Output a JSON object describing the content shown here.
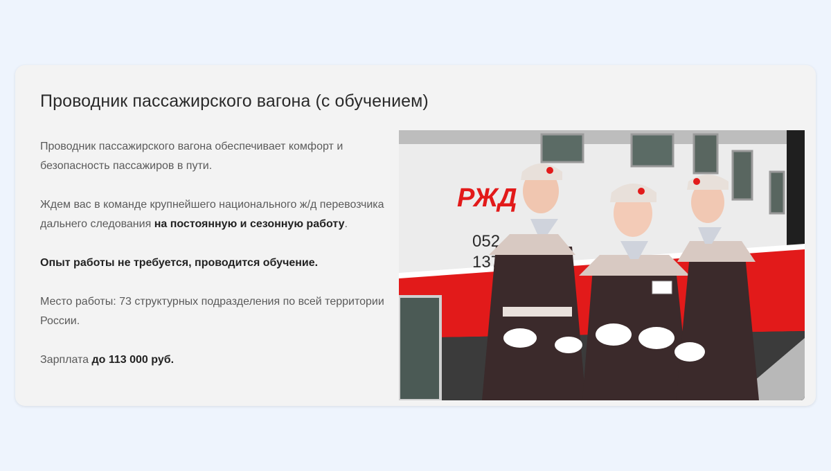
{
  "card": {
    "title": "Проводник пассажирского вагона (с обучением)",
    "p1": "Проводник пассажирского вагона обеспечивает комфорт и безопасность пассажиров в пути.",
    "p2_prefix": "Ждем вас в команде крупнейшего национального ж/д перевозчика дальнего следования ",
    "p2_bold": "на постоянную и сезонную работу",
    "p2_suffix": ".",
    "p3_bold": "Опыт работы не требуется, проводится обучение.",
    "p4": "Место работы: 73 структурных подразделения по всей территории России.",
    "p5_prefix": "Зарплата ",
    "p5_bold": "до 113 000 руб."
  },
  "photo": {
    "logo_text": "РЖД",
    "car_number_1": "052",
    "car_number_2": "137",
    "colors": {
      "brand_red": "#e21a1a",
      "uniform": "#3b2a2b",
      "trim": "#d8c9c2"
    }
  }
}
